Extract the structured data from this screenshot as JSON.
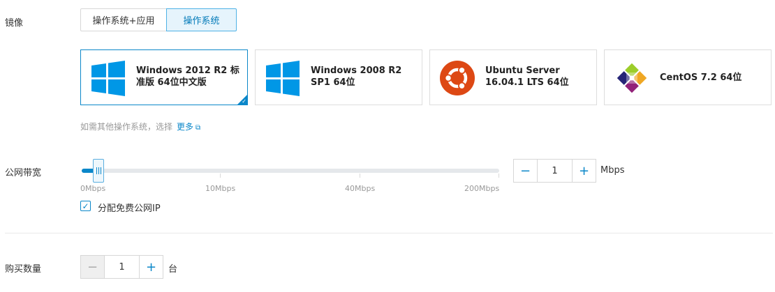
{
  "image_section": {
    "label": "镜像",
    "tabs": [
      {
        "label": "操作系统+应用",
        "active": false
      },
      {
        "label": "操作系统",
        "active": true
      }
    ],
    "os_options": [
      {
        "name": "Windows 2012 R2 标准版 64位中文版",
        "icon": "windows-icon",
        "selected": true
      },
      {
        "name": "Windows 2008 R2 SP1 64位",
        "icon": "windows-icon",
        "selected": false
      },
      {
        "name": "Ubuntu Server 16.04.1 LTS 64位",
        "icon": "ubuntu-icon",
        "selected": false
      },
      {
        "name": "CentOS 7.2 64位",
        "icon": "centos-icon",
        "selected": false
      }
    ],
    "hint_text": "如需其他操作系统，选择",
    "more_link": "更多"
  },
  "bandwidth": {
    "label": "公网带宽",
    "scale_labels": [
      "0Mbps",
      "10Mbps",
      "40Mbps",
      "200Mbps"
    ],
    "value": "1",
    "unit": "Mbps",
    "checkbox_label": "分配免费公网IP",
    "checkbox_checked": true
  },
  "quantity": {
    "label": "购买数量",
    "value": "1",
    "unit": "台"
  },
  "colors": {
    "accent": "#0b87c9",
    "windows_blue": "#0097e6",
    "ubuntu_orange": "#dd4814"
  }
}
